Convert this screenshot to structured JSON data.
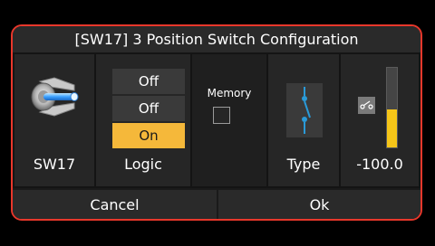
{
  "dialog": {
    "title": "[SW17]  3 Position Switch Configuration",
    "border_color": "#e8372b"
  },
  "switch_panel": {
    "icon": "toggle-switch-icon",
    "label": "SW17"
  },
  "logic_panel": {
    "options": [
      {
        "label": "Off",
        "active": false
      },
      {
        "label": "Off",
        "active": false
      },
      {
        "label": "On",
        "active": true
      }
    ],
    "label": "Logic",
    "active_color": "#f5b83a"
  },
  "memory": {
    "label": "Memory",
    "checked": false
  },
  "type_panel": {
    "icon": "three-position-switch-icon",
    "label": "Type"
  },
  "value_panel": {
    "icon": "switch-icon",
    "value_text": "-100.0",
    "gauge_fill_fraction": 0.48,
    "gauge_color": "#f5c518"
  },
  "buttons": {
    "cancel": "Cancel",
    "ok": "Ok"
  }
}
